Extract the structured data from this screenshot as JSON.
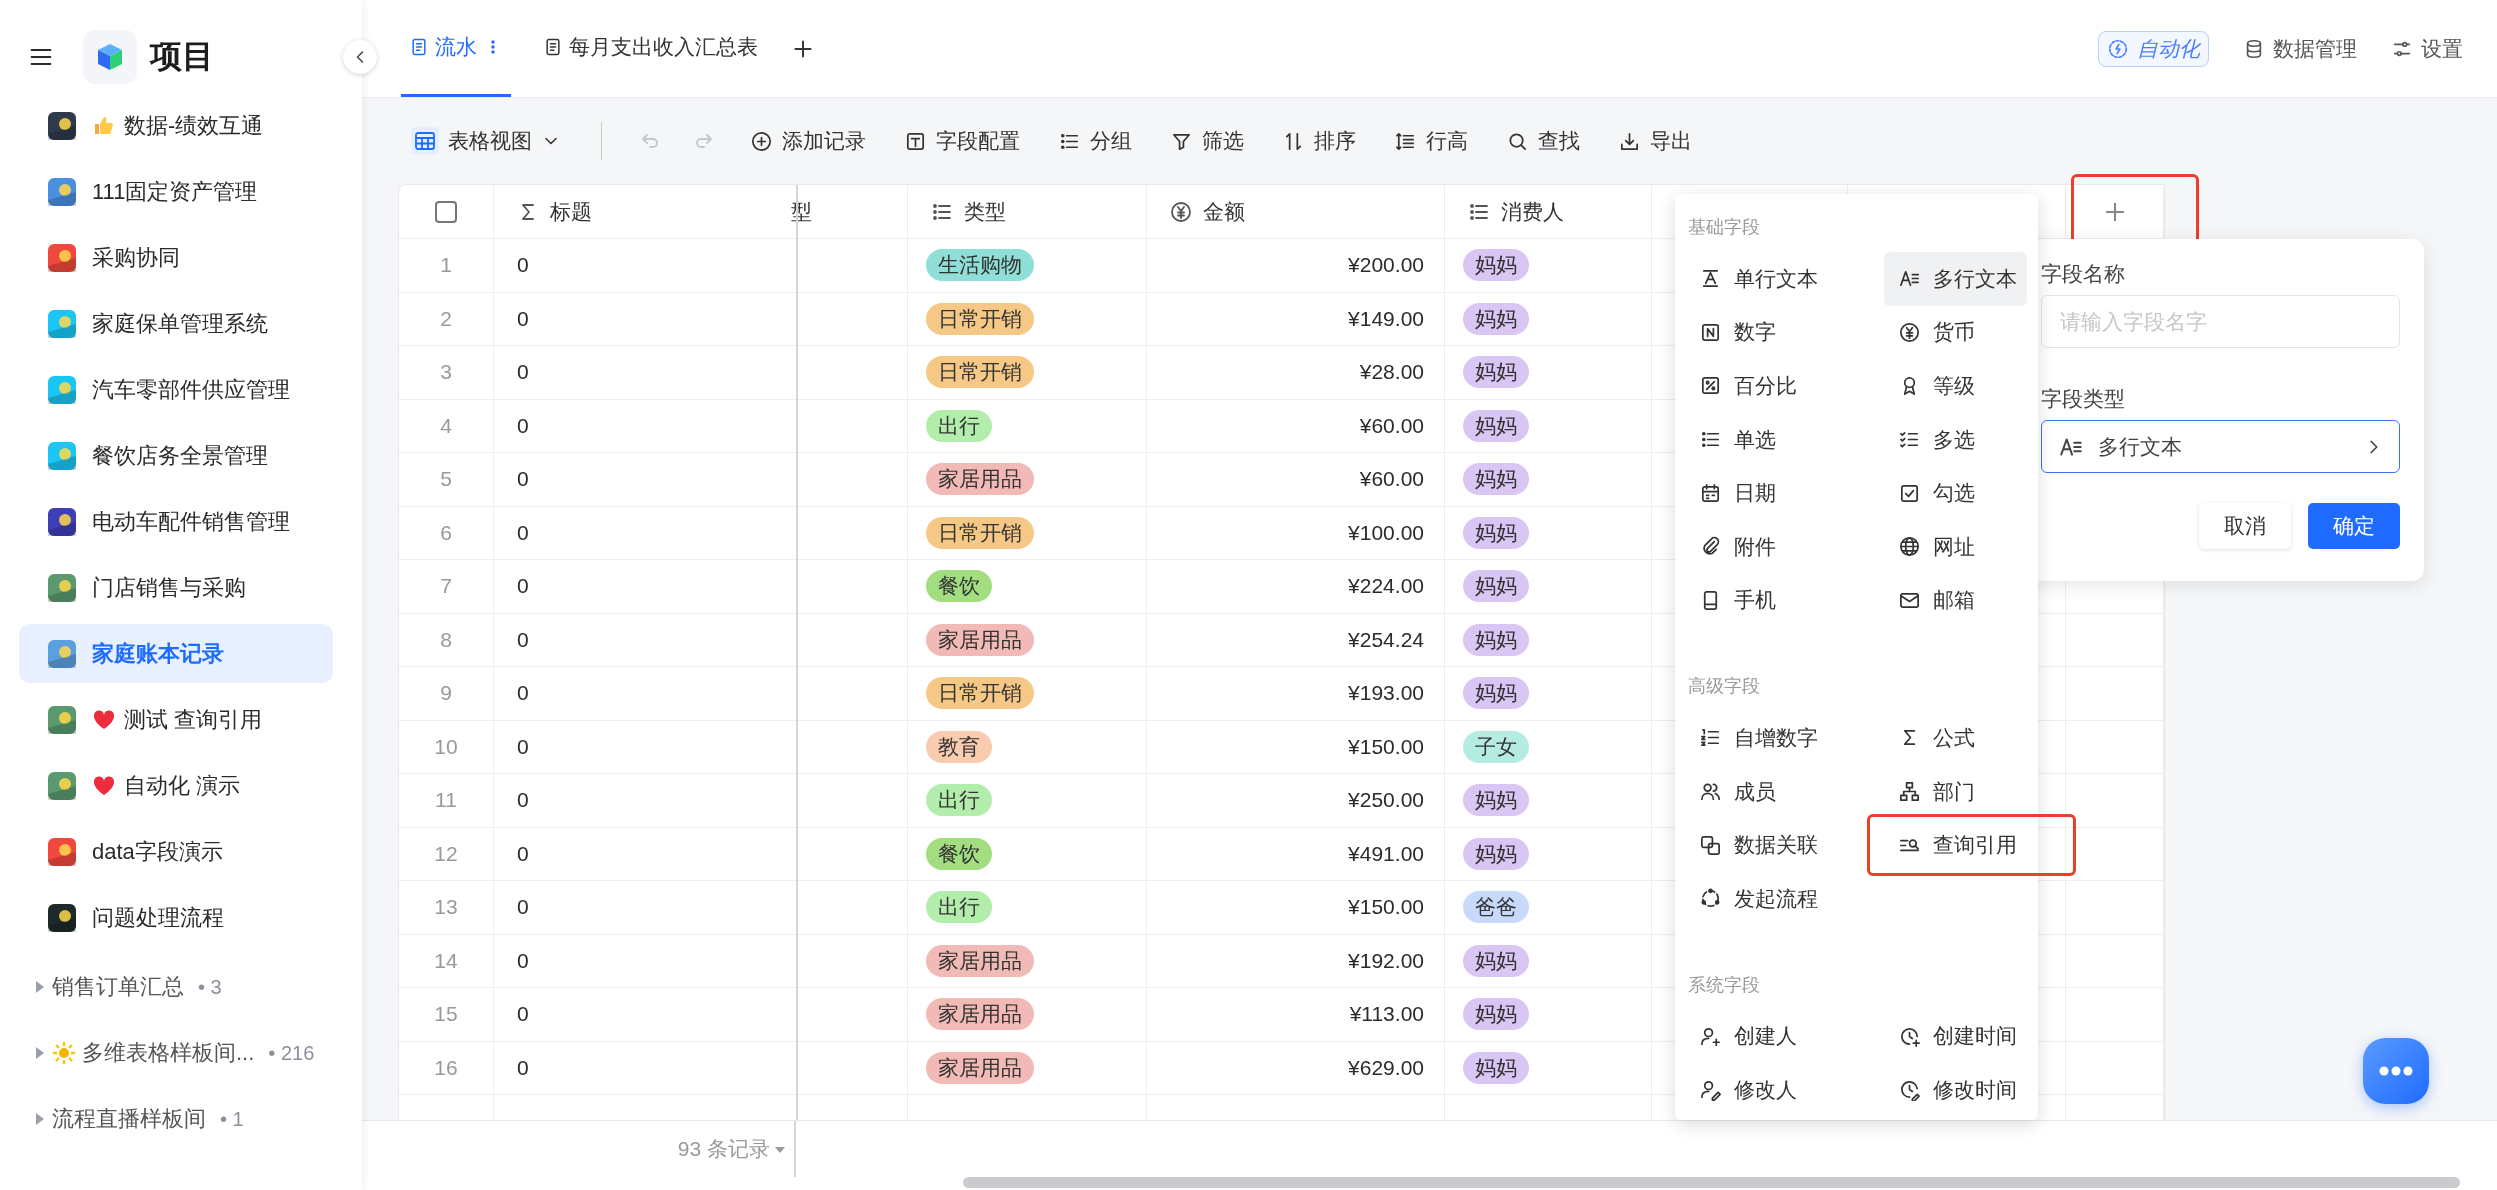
{
  "sidebar": {
    "title": "项目",
    "projects": [
      {
        "name": "数据-绩效互通",
        "kind": "thumb",
        "color": "#2e3a4c",
        "selected": false
      },
      {
        "name": "111固定资产管理",
        "kind": "plain",
        "color": "#4a8fe0",
        "selected": false
      },
      {
        "name": "采购协同",
        "kind": "plain",
        "color": "#f0483e",
        "selected": false
      },
      {
        "name": "家庭保单管理系统",
        "kind": "plain",
        "color": "#19c6f5",
        "selected": false
      },
      {
        "name": "汽车零部件供应管理",
        "kind": "plain",
        "color": "#19c6f5",
        "selected": false
      },
      {
        "name": "餐饮店务全景管理",
        "kind": "plain",
        "color": "#19c6f5",
        "selected": false
      },
      {
        "name": "电动车配件销售管理",
        "kind": "plain",
        "color": "#3d3fb8",
        "selected": false
      },
      {
        "name": "门店销售与采购",
        "kind": "plain",
        "color": "#5a9a6e",
        "selected": false
      },
      {
        "name": "家庭账本记录",
        "kind": "plain",
        "color": "#5aa0e0",
        "selected": true
      },
      {
        "name": "测试 查询引用",
        "kind": "heart",
        "color": "#5a9a6e",
        "selected": false
      },
      {
        "name": "自动化 演示",
        "kind": "heart",
        "color": "#5a9a6e",
        "selected": false
      },
      {
        "name": "data字段演示",
        "kind": "plain",
        "color": "#f0483e",
        "selected": false
      },
      {
        "name": "问题处理流程",
        "kind": "plain",
        "color": "#1e2a2a",
        "selected": false
      }
    ],
    "groups": [
      {
        "name": "销售订单汇总",
        "kind": "plain",
        "count": "• 3"
      },
      {
        "name": "多维表格样板间...",
        "kind": "sun",
        "count": "• 216"
      },
      {
        "name": "流程直播样板间",
        "kind": "plain",
        "count": "• 1"
      }
    ]
  },
  "tabs": [
    {
      "label": "流水",
      "selected": true
    },
    {
      "label": "每月支出收入汇总表",
      "selected": false
    }
  ],
  "header_actions": [
    {
      "kind": "automation",
      "label": "自动化"
    },
    {
      "kind": "database",
      "label": "数据管理"
    },
    {
      "kind": "settings",
      "label": "设置"
    }
  ],
  "toolbar": {
    "view": "表格视图",
    "history": [
      {
        "kind": "undo",
        "disabled": true
      },
      {
        "kind": "redo",
        "disabled": true
      }
    ],
    "actions": [
      {
        "kind": "add",
        "label": "添加记录"
      },
      {
        "kind": "fields",
        "label": "字段配置"
      },
      {
        "kind": "group",
        "label": "分组"
      },
      {
        "kind": "filter",
        "label": "筛选"
      },
      {
        "kind": "sort",
        "label": "排序"
      },
      {
        "kind": "row-height",
        "label": "行高"
      },
      {
        "kind": "search",
        "label": "查找"
      },
      {
        "kind": "export",
        "label": "导出"
      }
    ]
  },
  "table": {
    "select_all": {
      "checked": false
    },
    "columns": [
      {
        "label": "标题",
        "kind": "formula"
      },
      {
        "label": "型",
        "kind": "partial"
      },
      {
        "label": "类型",
        "kind": "single-select"
      },
      {
        "label": "金额",
        "kind": "currency"
      },
      {
        "label": "消费人",
        "kind": "single-select"
      }
    ],
    "add_column": {
      "highlighted": true
    },
    "rows": [
      {
        "number": "1",
        "title": "0",
        "type": {
          "label": "生活购物",
          "color": "#8fded8"
        },
        "amount": "¥200.00",
        "consumer": {
          "label": "妈妈",
          "color": "#dac6f4"
        }
      },
      {
        "number": "2",
        "title": "0",
        "type": {
          "label": "日常开销",
          "color": "#f6c885"
        },
        "amount": "¥149.00",
        "consumer": {
          "label": "妈妈",
          "color": "#dac6f4"
        }
      },
      {
        "number": "3",
        "title": "0",
        "type": {
          "label": "日常开销",
          "color": "#f6c885"
        },
        "amount": "¥28.00",
        "consumer": {
          "label": "妈妈",
          "color": "#dac6f4"
        }
      },
      {
        "number": "4",
        "title": "0",
        "type": {
          "label": "出行",
          "color": "#b3edab"
        },
        "amount": "¥60.00",
        "consumer": {
          "label": "妈妈",
          "color": "#dac6f4"
        }
      },
      {
        "number": "5",
        "title": "0",
        "type": {
          "label": "家居用品",
          "color": "#f2bab6"
        },
        "amount": "¥60.00",
        "consumer": {
          "label": "妈妈",
          "color": "#dac6f4"
        }
      },
      {
        "number": "6",
        "title": "0",
        "type": {
          "label": "日常开销",
          "color": "#f6c885"
        },
        "amount": "¥100.00",
        "consumer": {
          "label": "妈妈",
          "color": "#dac6f4"
        }
      },
      {
        "number": "7",
        "title": "0",
        "type": {
          "label": "餐饮",
          "color": "#a2de80"
        },
        "amount": "¥224.00",
        "consumer": {
          "label": "妈妈",
          "color": "#dac6f4"
        }
      },
      {
        "number": "8",
        "title": "0",
        "type": {
          "label": "家居用品",
          "color": "#f2bab6"
        },
        "amount": "¥254.24",
        "consumer": {
          "label": "妈妈",
          "color": "#dac6f4"
        }
      },
      {
        "number": "9",
        "title": "0",
        "type": {
          "label": "日常开销",
          "color": "#f6c885"
        },
        "amount": "¥193.00",
        "consumer": {
          "label": "妈妈",
          "color": "#dac6f4"
        }
      },
      {
        "number": "10",
        "title": "0",
        "type": {
          "label": "教育",
          "color": "#f9cbaf"
        },
        "amount": "¥150.00",
        "consumer": {
          "label": "子女",
          "color": "#b4ece2"
        }
      },
      {
        "number": "11",
        "title": "0",
        "type": {
          "label": "出行",
          "color": "#b3edab"
        },
        "amount": "¥250.00",
        "consumer": {
          "label": "妈妈",
          "color": "#dac6f4"
        }
      },
      {
        "number": "12",
        "title": "0",
        "type": {
          "label": "餐饮",
          "color": "#a2de80"
        },
        "amount": "¥491.00",
        "consumer": {
          "label": "妈妈",
          "color": "#dac6f4"
        }
      },
      {
        "number": "13",
        "title": "0",
        "type": {
          "label": "出行",
          "color": "#b3edab"
        },
        "amount": "¥150.00",
        "consumer": {
          "label": "爸爸",
          "color": "#c8dafc"
        }
      },
      {
        "number": "14",
        "title": "0",
        "type": {
          "label": "家居用品",
          "color": "#f2bab6"
        },
        "amount": "¥192.00",
        "consumer": {
          "label": "妈妈",
          "color": "#dac6f4"
        }
      },
      {
        "number": "15",
        "title": "0",
        "type": {
          "label": "家居用品",
          "color": "#f2bab6"
        },
        "amount": "¥113.00",
        "consumer": {
          "label": "妈妈",
          "color": "#dac6f4"
        }
      },
      {
        "number": "16",
        "title": "0",
        "type": {
          "label": "家居用品",
          "color": "#f2bab6"
        },
        "amount": "¥629.00",
        "consumer": {
          "label": "妈妈",
          "color": "#dac6f4"
        }
      }
    ],
    "record_count": "93 条记录"
  },
  "field_menu": {
    "sections": [
      {
        "title": "基础字段",
        "items": [
          {
            "label": "单行文本",
            "kind": "single-line",
            "selected": false,
            "highlighted": false
          },
          {
            "label": "多行文本",
            "kind": "multi-line",
            "selected": true,
            "highlighted": false
          },
          {
            "label": "数字",
            "kind": "number",
            "selected": false,
            "highlighted": false
          },
          {
            "label": "货币",
            "kind": "currency",
            "selected": false,
            "highlighted": false
          },
          {
            "label": "百分比",
            "kind": "percent",
            "selected": false,
            "highlighted": false
          },
          {
            "label": "等级",
            "kind": "rating",
            "selected": false,
            "highlighted": false
          },
          {
            "label": "单选",
            "kind": "single-select",
            "selected": false,
            "highlighted": false
          },
          {
            "label": "多选",
            "kind": "multi-select",
            "selected": false,
            "highlighted": false
          },
          {
            "label": "日期",
            "kind": "date",
            "selected": false,
            "highlighted": false
          },
          {
            "label": "勾选",
            "kind": "checkbox",
            "selected": false,
            "highlighted": false
          },
          {
            "label": "附件",
            "kind": "attachment",
            "selected": false,
            "highlighted": false
          },
          {
            "label": "网址",
            "kind": "url",
            "selected": false,
            "highlighted": false
          },
          {
            "label": "手机",
            "kind": "phone",
            "selected": false,
            "highlighted": false
          },
          {
            "label": "邮箱",
            "kind": "email",
            "selected": false,
            "highlighted": false
          }
        ]
      },
      {
        "title": "高级字段",
        "items": [
          {
            "label": "自增数字",
            "kind": "autonumber",
            "selected": false,
            "highlighted": false
          },
          {
            "label": "公式",
            "kind": "formula",
            "selected": false,
            "highlighted": false
          },
          {
            "label": "成员",
            "kind": "member",
            "selected": false,
            "highlighted": false
          },
          {
            "label": "部门",
            "kind": "department",
            "selected": false,
            "highlighted": false
          },
          {
            "label": "数据关联",
            "kind": "relation",
            "selected": false,
            "highlighted": false
          },
          {
            "label": "查询引用",
            "kind": "lookup",
            "selected": false,
            "highlighted": true
          },
          {
            "label": "发起流程",
            "kind": "workflow",
            "selected": false,
            "highlighted": false
          }
        ]
      },
      {
        "title": "系统字段",
        "items": [
          {
            "label": "创建人",
            "kind": "creator",
            "selected": false,
            "highlighted": false
          },
          {
            "label": "创建时间",
            "kind": "created-time",
            "selected": false,
            "highlighted": false
          },
          {
            "label": "修改人",
            "kind": "modifier",
            "selected": false,
            "highlighted": false
          },
          {
            "label": "修改时间",
            "kind": "modified-time",
            "selected": false,
            "highlighted": false
          }
        ]
      }
    ]
  },
  "field_form": {
    "name_label": "字段名称",
    "name_placeholder": "请输入字段名字",
    "type_label": "字段类型",
    "type_value": "多行文本",
    "buttons": [
      {
        "label": "取消",
        "kind": "secondary"
      },
      {
        "label": "确定",
        "kind": "primary"
      }
    ]
  }
}
